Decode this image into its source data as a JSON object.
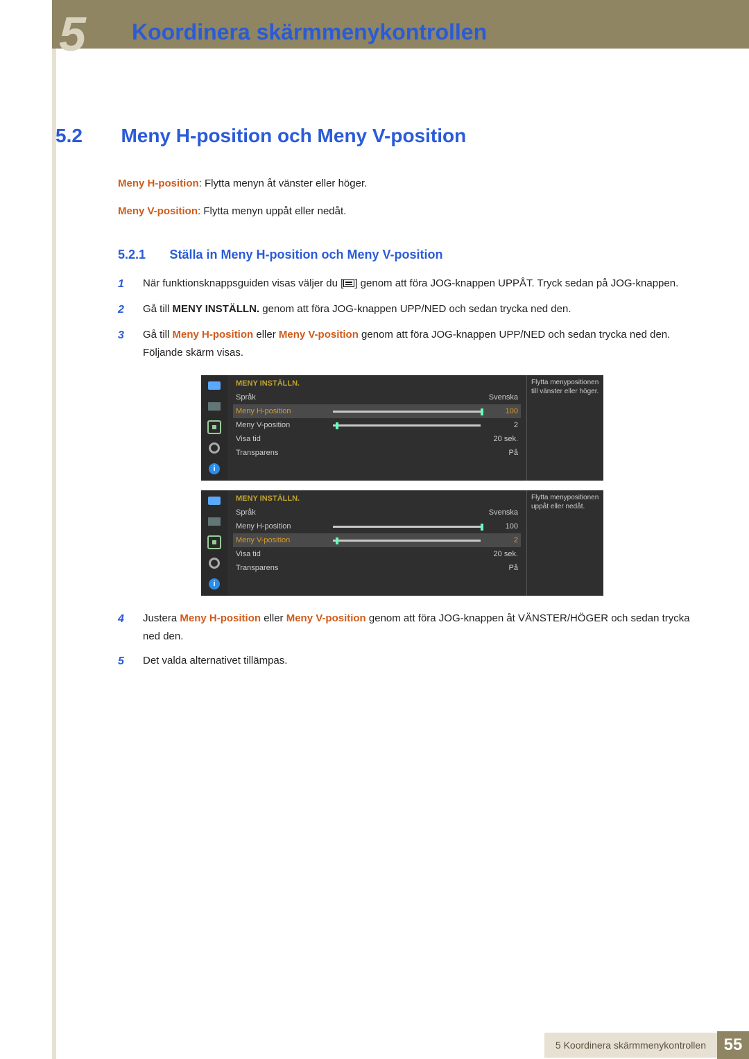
{
  "header": {
    "chapter_glyph": "5",
    "title": "Koordinera skärmmenykontrollen"
  },
  "section": {
    "num": "5.2",
    "title": "Meny H-position och Meny V-position"
  },
  "intro": {
    "h_label": "Meny H-position",
    "h_text": ": Flytta menyn åt vänster eller höger.",
    "v_label": "Meny V-position",
    "v_text": ": Flytta menyn uppåt eller nedåt."
  },
  "subsection": {
    "num": "5.2.1",
    "title": "Ställa in Meny H-position och Meny V-position"
  },
  "steps": {
    "s1a": "När funktionsknappsguiden visas väljer du [",
    "s1b": "] genom att föra JOG-knappen UPPÅT. Tryck sedan på JOG-knappen.",
    "s2a": "Gå till ",
    "s2b": "MENY INSTÄLLN.",
    "s2c": " genom att föra JOG-knappen UPP/NED och sedan trycka ned den.",
    "s3a": "Gå till ",
    "s3b": "Meny H-position",
    "s3c": " eller ",
    "s3d": "Meny V-position",
    "s3e": " genom att föra JOG-knappen UPP/NED och sedan trycka ned den. Följande skärm visas.",
    "s4a": "Justera ",
    "s4b": "Meny H-position",
    "s4c": " eller ",
    "s4d": "Meny V-position",
    "s4e": " genom att föra JOG-knappen åt VÄNSTER/HÖGER och sedan trycka ned den.",
    "s5": "Det valda alternativet tillämpas.",
    "n1": "1",
    "n2": "2",
    "n3": "3",
    "n4": "4",
    "n5": "5"
  },
  "osd": {
    "title": "MENY INSTÄLLN.",
    "rows": {
      "sprak": "Språk",
      "sprak_val": "Svenska",
      "h": "Meny H-position",
      "h_val": "100",
      "v": "Meny V-position",
      "v_val": "2",
      "visa": "Visa tid",
      "visa_val": "20 sek.",
      "trans": "Transparens",
      "trans_val": "På"
    },
    "tip1": "Flytta menypositionen till vänster eller höger.",
    "tip2": "Flytta menypositionen uppåt eller nedåt.",
    "info_glyph": "i"
  },
  "footer": {
    "label": "5 Koordinera skärmmenykontrollen",
    "page": "55"
  }
}
